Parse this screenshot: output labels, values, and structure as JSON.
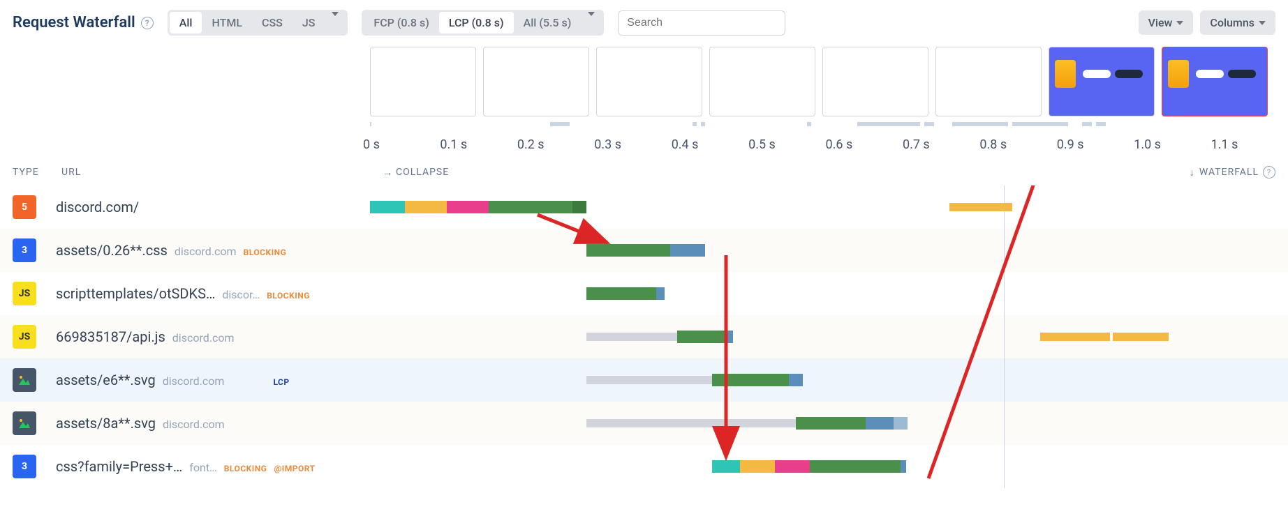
{
  "title": "Request Waterfall",
  "filter_tabs": {
    "all": "All",
    "html": "HTML",
    "css": "CSS",
    "js": "JS"
  },
  "metric_tabs": {
    "fcp": "FCP (0.8 s)",
    "lcp": "LCP (0.8 s)",
    "all": "All (5.5 s)"
  },
  "search_placeholder": "Search",
  "view_btn": "View",
  "columns_btn": "Columns",
  "axis_ticks": [
    "0 s",
    "0.1 s",
    "0.2 s",
    "0.3 s",
    "0.4 s",
    "0.5 s",
    "0.6 s",
    "0.7 s",
    "0.8 s",
    "0.9 s",
    "1.0 s",
    "1.1 s"
  ],
  "col_type": "TYPE",
  "col_url": "URL",
  "collapse": "COLLAPSE",
  "waterfall_hdr": "WATERFALL",
  "badges": {
    "blocking": "BLOCKING",
    "lcp": "LCP",
    "import": "@IMPORT"
  },
  "rows": [
    {
      "icon": "html",
      "url": "discord.com/",
      "domain": "",
      "badges": []
    },
    {
      "icon": "css",
      "url": "assets/0.26**.css",
      "domain": "discord.com",
      "badges": [
        "blocking"
      ]
    },
    {
      "icon": "js",
      "url": "scripttemplates/otSDKS…",
      "domain": "discor…",
      "badges": [
        "blocking"
      ]
    },
    {
      "icon": "js",
      "url": "669835187/api.js",
      "domain": "discord.com",
      "badges": []
    },
    {
      "icon": "img",
      "url": "assets/e6**.svg",
      "domain": "discord.com",
      "badges": [
        "lcp"
      ]
    },
    {
      "icon": "img",
      "url": "assets/8a**.svg",
      "domain": "discord.com",
      "badges": []
    },
    {
      "icon": "css",
      "url": "css?family=Press+…",
      "domain": "font…",
      "badges": [
        "blocking",
        "import"
      ]
    }
  ]
}
